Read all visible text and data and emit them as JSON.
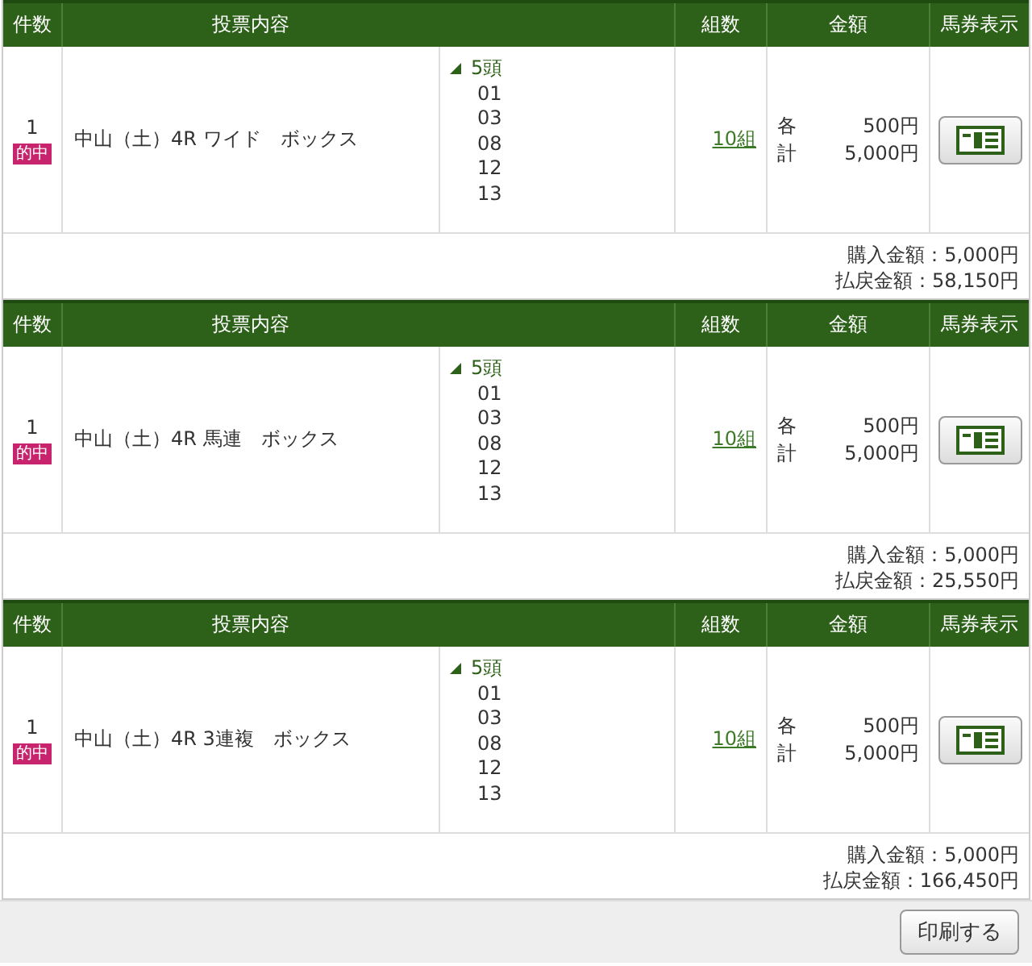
{
  "bets": [
    {
      "columns": [
        "件数",
        "投票内容",
        "組数",
        "金額",
        "馬券表示"
      ],
      "count": "1",
      "badge": "的中",
      "content": "中山（土）4R ワイド　ボックス",
      "horses": {
        "expanded": true,
        "label": "5頭",
        "numbers": [
          "01",
          "03",
          "08",
          "12",
          "13"
        ]
      },
      "combos": "10組",
      "each_label": "各",
      "each": "500円",
      "total_label": "計",
      "total": "5,000円",
      "purchase": "購入金額：5,000円",
      "payout": "払戻金額：58,150円"
    },
    {
      "columns": [
        "件数",
        "投票内容",
        "組数",
        "金額",
        "馬券表示"
      ],
      "count": "1",
      "badge": "的中",
      "content": "中山（土）4R 馬連　ボックス",
      "horses": {
        "expanded": true,
        "label": "5頭",
        "numbers": [
          "01",
          "03",
          "08",
          "12",
          "13"
        ]
      },
      "combos": "10組",
      "each_label": "各",
      "each": "500円",
      "total_label": "計",
      "total": "5,000円",
      "purchase": "購入金額：5,000円",
      "payout": "払戻金額：25,550円"
    },
    {
      "columns": [
        "件数",
        "投票内容",
        "組数",
        "金額",
        "馬券表示"
      ],
      "count": "1",
      "badge": "的中",
      "content": "中山（土）4R 3連複　ボックス",
      "horses": {
        "expanded": true,
        "label": "5頭",
        "numbers": [
          "01",
          "03",
          "08",
          "12",
          "13"
        ]
      },
      "combos": "10組",
      "each_label": "各",
      "each": "500円",
      "total_label": "計",
      "total": "5,000円",
      "purchase": "購入金額：5,000円",
      "payout": "払戻金額：166,450円"
    }
  ],
  "print_button": "印刷する"
}
